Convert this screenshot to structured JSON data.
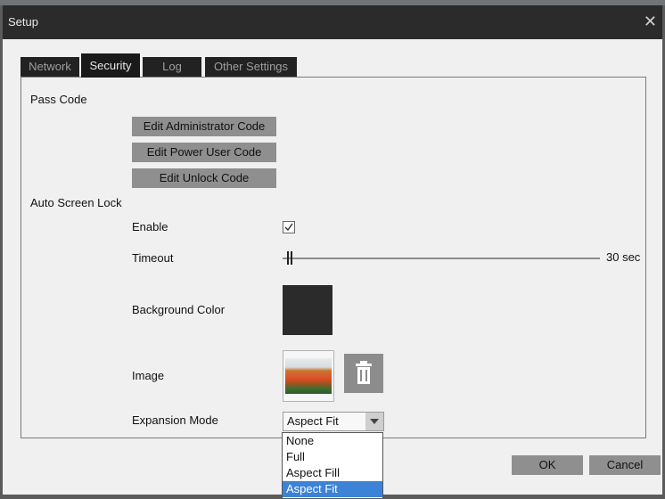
{
  "window": {
    "title": "Setup",
    "close_glyph": "✕"
  },
  "tabs": [
    {
      "label": "Network",
      "active": false
    },
    {
      "label": "Security",
      "active": true
    },
    {
      "label": "Log",
      "active": false
    },
    {
      "label": "Other Settings",
      "active": false
    }
  ],
  "pass_code": {
    "heading": "Pass Code",
    "buttons": [
      "Edit Administrator Code",
      "Edit Power User Code",
      "Edit Unlock Code"
    ]
  },
  "auto_screen_lock": {
    "heading": "Auto Screen Lock",
    "enable": {
      "label": "Enable",
      "checked": true
    },
    "timeout": {
      "label": "Timeout",
      "value_text": "30 sec",
      "position_fraction": 0.02
    },
    "background_color": {
      "label": "Background Color",
      "color": "#2b2b2b"
    },
    "image": {
      "label": "Image",
      "delete_icon": "trash-icon"
    },
    "expansion_mode": {
      "label": "Expansion Mode",
      "selected": "Aspect Fit",
      "options": [
        "None",
        "Full",
        "Aspect Fill",
        "Aspect Fit"
      ]
    }
  },
  "footer": {
    "ok_label": "OK",
    "cancel_label": "Cancel"
  },
  "colors": {
    "dark_tab": "#1a1a1a",
    "button_grey": "#8f8f8f",
    "selection_blue": "#3c82d7"
  }
}
